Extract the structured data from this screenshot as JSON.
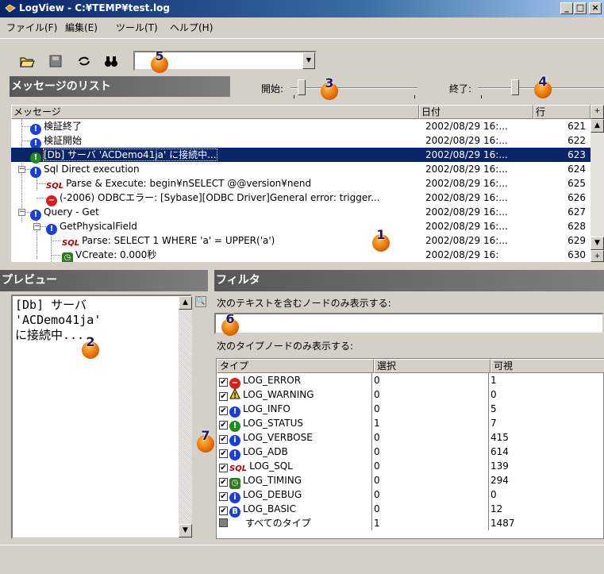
{
  "window": {
    "title": "LogView - C:¥TEMP¥test.log"
  },
  "menu": [
    "ファイル(F)",
    "編集(E)",
    "ツール(T)",
    "ヘルプ(H)"
  ],
  "toolbar": {
    "search_value": ""
  },
  "message_list": {
    "header": "メッセージのリスト",
    "start_label": "開始:",
    "end_label": "終了:",
    "columns": {
      "message": "メッセージ",
      "date": "日付",
      "line": "行"
    },
    "rows": [
      {
        "icon": "info-icon",
        "text": "検証終了",
        "date": "2002/08/29 16:...",
        "line": "621"
      },
      {
        "icon": "info-icon",
        "text": "検証開始",
        "date": "2002/08/29 16:...",
        "line": "622"
      },
      {
        "icon": "status-icon",
        "text": "[Db] サーバ 'ACDemo41ja' に接続中...",
        "date": "2002/08/29 16:...",
        "line": "623"
      },
      {
        "icon": "info-icon",
        "text": "Sql Direct execution",
        "date": "2002/08/29 16:...",
        "line": "624"
      },
      {
        "icon": "sql-icon",
        "text": "Parse & Execute: begin¥nSELECT @@version¥nend",
        "date": "2002/08/29 16:...",
        "line": "625"
      },
      {
        "icon": "error-icon",
        "text": "(-2006) ODBCエラー: [Sybase][ODBC Driver]General error: trigger...",
        "date": "2002/08/29 16:...",
        "line": "626"
      },
      {
        "icon": "info-icon",
        "text": "Query - Get",
        "date": "2002/08/29 16:...",
        "line": "627"
      },
      {
        "icon": "info-icon",
        "text": "GetPhysicalField",
        "date": "2002/08/29 16:...",
        "line": "628"
      },
      {
        "icon": "sql-icon",
        "text": "Parse: SELECT 1 WHERE 'a' = UPPER('a')",
        "date": "2002/08/29 16:...",
        "line": "629"
      },
      {
        "icon": "timing-icon",
        "text": "VCreate: 0.000秒",
        "date": "2002/08/29 16:",
        "line": "630"
      }
    ]
  },
  "preview": {
    "header": "プレビュー",
    "lines": [
      "[Db] サーバ",
      "'ACDemo41ja'",
      "に接続中..."
    ]
  },
  "filter": {
    "header": "フィルタ",
    "text_label": "次のテキストを含むノードのみ表示する:",
    "text_value": "",
    "type_label": "次のタイプノードのみ表示する:",
    "columns": {
      "type": "タイプ",
      "selected": "選択",
      "visible": "可視"
    },
    "rows": [
      {
        "checked": true,
        "icon": "error-icon",
        "type": "LOG_ERROR",
        "selected": "0",
        "visible": "1"
      },
      {
        "checked": true,
        "icon": "warning-icon",
        "type": "LOG_WARNING",
        "selected": "0",
        "visible": "0"
      },
      {
        "checked": true,
        "icon": "info-icon",
        "type": "LOG_INFO",
        "selected": "0",
        "visible": "5"
      },
      {
        "checked": true,
        "icon": "status-icon",
        "type": "LOG_STATUS",
        "selected": "1",
        "visible": "7"
      },
      {
        "checked": true,
        "icon": "verbose-icon",
        "type": "LOG_VERBOSE",
        "selected": "0",
        "visible": "415"
      },
      {
        "checked": true,
        "icon": "adb-icon",
        "type": "LOG_ADB",
        "selected": "0",
        "visible": "614"
      },
      {
        "checked": true,
        "icon": "sql-icon",
        "type": "LOG_SQL",
        "selected": "0",
        "visible": "139"
      },
      {
        "checked": true,
        "icon": "timing-icon",
        "type": "LOG_TIMING",
        "selected": "0",
        "visible": "294"
      },
      {
        "checked": true,
        "icon": "debug-icon",
        "type": "LOG_DEBUG",
        "selected": "0",
        "visible": "0"
      },
      {
        "checked": true,
        "icon": "basic-icon",
        "type": "LOG_BASIC",
        "selected": "0",
        "visible": "12"
      },
      {
        "checked": "partial",
        "icon": "",
        "type": "すべてのタイプ",
        "selected": "1",
        "visible": "1487"
      }
    ]
  },
  "callouts": [
    "1",
    "2",
    "3",
    "4",
    "5",
    "6",
    "7"
  ],
  "colors": {
    "selection": "#0a246a",
    "section_header": "#6a6a6a",
    "callout": "#e56b00"
  }
}
